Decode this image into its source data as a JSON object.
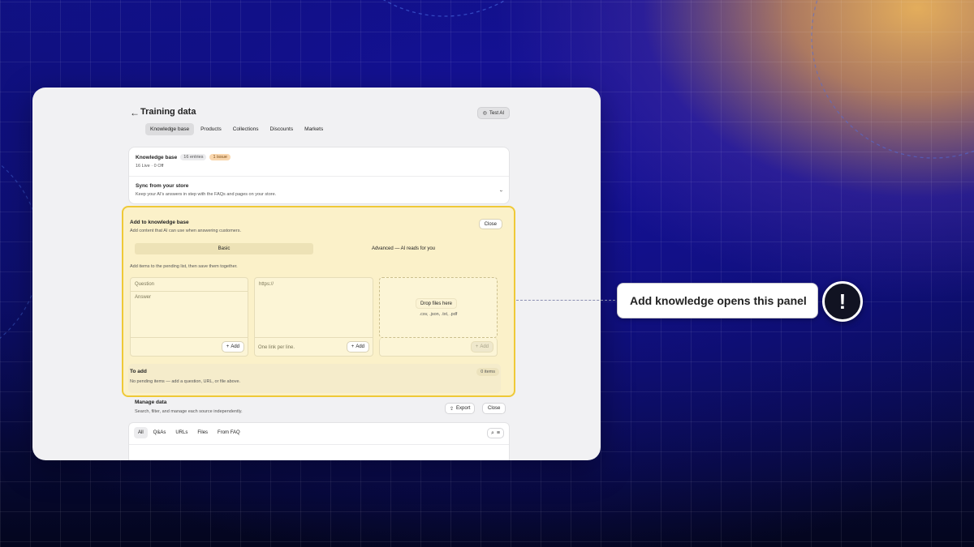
{
  "header": {
    "back_icon": "arrow-left-icon",
    "title": "Training data",
    "test_ai_label": "Test AI",
    "test_ai_icon": "sparkle-icon"
  },
  "tabs": [
    {
      "label": "Knowledge base",
      "active": true
    },
    {
      "label": "Products",
      "active": false
    },
    {
      "label": "Collections",
      "active": false
    },
    {
      "label": "Discounts",
      "active": false
    },
    {
      "label": "Markets",
      "active": false
    }
  ],
  "knowledge_base": {
    "title": "Knowledge base",
    "entries_badge": "16 entries",
    "issue_badge": "1 issue",
    "status": "16 Live · 0 Off"
  },
  "sync": {
    "title": "Sync from your store",
    "subtitle": "Keep your AI's answers in step with the FAQs and pages on your store.",
    "chevron_icon": "chevron-down-icon"
  },
  "add_panel": {
    "title": "Add to knowledge base",
    "subtitle": "Add content that AI can use when answering customers.",
    "close_label": "Close",
    "mode_basic": "Basic",
    "mode_advanced": "Advanced — AI reads for you",
    "hint": "Add items to the pending list, then save them together.",
    "question_placeholder": "Question",
    "answer_placeholder": "Answer",
    "add_label": "Add",
    "url_placeholder": "https://",
    "url_hint": "One link per line.",
    "drop_label": "Drop files here",
    "drop_types": ".csv, .json, .txt, .pdf",
    "todo_title": "To add",
    "todo_empty": "No pending items — add a question, URL, or file above.",
    "todo_count": "0 items"
  },
  "manage": {
    "title": "Manage data",
    "subtitle": "Search, filter, and manage each source independently.",
    "export_label": "Export",
    "close_label": "Close",
    "filters": [
      {
        "label": "All",
        "active": true
      },
      {
        "label": "Q&As",
        "active": false
      },
      {
        "label": "URLs",
        "active": false
      },
      {
        "label": "Files",
        "active": false
      },
      {
        "label": "From FAQ",
        "active": false
      }
    ]
  },
  "callout": {
    "text": "Add knowledge opens this panel",
    "badge": "!"
  },
  "colors": {
    "highlight_border": "#efc937",
    "panel_bg": "#fbf1c9",
    "issue_badge": "#f9d6ad"
  }
}
